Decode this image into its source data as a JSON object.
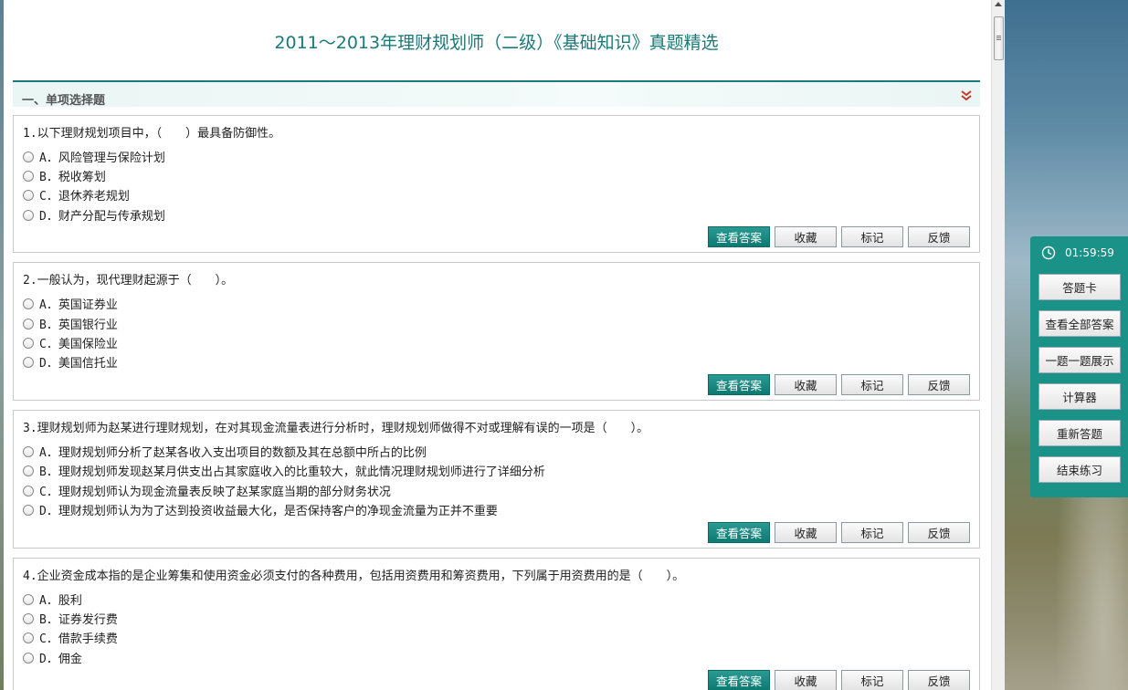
{
  "page": {
    "title": "2011～2013年理财规划师（二级）《基础知识》真题精选",
    "accent": "#1a7a78"
  },
  "section": {
    "title": "一、单项选择题"
  },
  "buttons": {
    "view_answer": "查看答案",
    "favorite": "收藏",
    "mark": "标记",
    "feedback": "反馈"
  },
  "questions": [
    {
      "text": "1.以下理财规划项目中，（　　）最具备防御性。",
      "options": [
        "A．风险管理与保险计划",
        "B．税收筹划",
        "C．退休养老规划",
        "D．财产分配与传承规划"
      ]
    },
    {
      "text": "2.一般认为，现代理财起源于（　　）。",
      "options": [
        "A．英国证券业",
        "B．英国银行业",
        "C．美国保险业",
        "D．美国信托业"
      ]
    },
    {
      "text": "3.理财规划师为赵某进行理财规划，在对其现金流量表进行分析时，理财规划师做得不对或理解有误的一项是（　　）。",
      "options": [
        "A．理财规划师分析了赵某各收入支出项目的数额及其在总额中所占的比例",
        "B．理财规划师发现赵某月供支出占其家庭收入的比重较大，就此情况理财规划师进行了详细分析",
        "C．理财规划师认为现金流量表反映了赵某家庭当期的部分财务状况",
        "D．理财规划师认为为了达到投资收益最大化，是否保持客户的净现金流量为正并不重要"
      ]
    },
    {
      "text": "4.企业资金成本指的是企业筹集和使用资金必须支付的各种费用，包括用资费用和筹资费用，下列属于用资费用的是（　　）。",
      "options": [
        "A．股利",
        "B．证券发行费",
        "C．借款手续费",
        "D．佣金"
      ]
    }
  ],
  "side_panel": {
    "timer": "01:59:59",
    "buttons": [
      "答题卡",
      "查看全部答案",
      "一题一题展示",
      "计算器",
      "重新答题",
      "结束练习"
    ],
    "color": "#1a9288"
  }
}
